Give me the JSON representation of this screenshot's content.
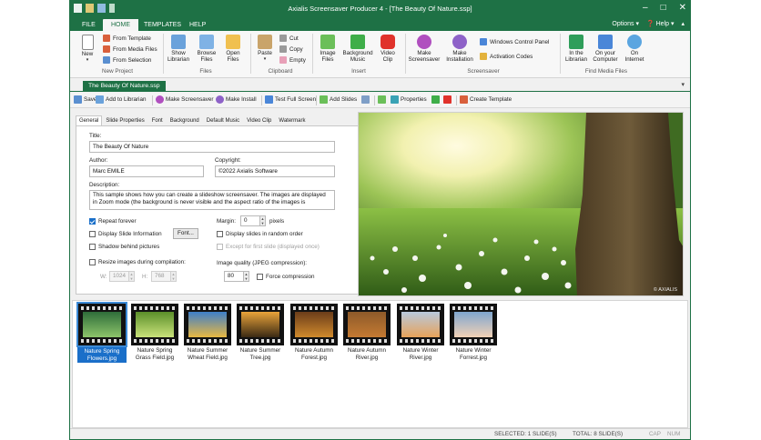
{
  "window": {
    "title": "Axialis Screensaver Producer 4 - [The Beauty Of Nature.ssp]",
    "controls": [
      "–",
      "□",
      "✕"
    ]
  },
  "menu_tabs": [
    "FILE",
    "HOME",
    "TEMPLATES",
    "HELP"
  ],
  "menu_right": {
    "options": "Options ▾",
    "help": "❓ Help ▾",
    "collapse": "▴"
  },
  "ribbon": {
    "groups": {
      "new_project": {
        "label": "New Project",
        "new": "New",
        "from_template": "From Template",
        "from_media": "From Media Files",
        "from_selection": "From Selection"
      },
      "files": {
        "label": "Files",
        "show_librarian": "Show Librarian",
        "browse_files": "Browse Files",
        "open_files": "Open Files"
      },
      "clipboard": {
        "label": "Clipboard",
        "paste": "Paste",
        "cut": "Cut",
        "copy": "Copy",
        "empty": "Empty"
      },
      "insert": {
        "label": "Insert",
        "image_files": "Image Files",
        "background_music": "Background Music",
        "video_clip": "Video Clip"
      },
      "screensaver": {
        "label": "Screensaver",
        "make_screensaver": "Make Screensaver",
        "make_installation": "Make Installation",
        "windows_control_panel": "Windows Control Panel",
        "activation_codes": "Activation Codes"
      },
      "find_media": {
        "label": "Find Media Files",
        "in_librarian": "In the Librarian",
        "on_computer": "On your Computer",
        "on_internet": "On Internet"
      }
    }
  },
  "document_tab": "The Beauty Of Nature.ssp",
  "toolbar": {
    "save": "Save",
    "add_to_librarian": "Add to Librarian",
    "make_screensaver": "Make Screensaver",
    "make_install": "Make Install",
    "test_full_screen": "Test Full Screen",
    "add_slides": "Add Slides",
    "properties": "Properties",
    "create_template": "Create Template"
  },
  "properties": {
    "tabs": [
      "General",
      "Slide Properties",
      "Font",
      "Background",
      "Default Music",
      "Video Clip",
      "Watermark"
    ],
    "title_label": "Title:",
    "title_value": "The Beauty Of Nature",
    "author_label": "Author:",
    "author_value": "Marc EMILE",
    "copyright_label": "Copyright:",
    "copyright_value": "©2022 Axialis Software",
    "description_label": "Description:",
    "description_value": "This sample shows how you can create a slideshow screensaver. The images are displayed in Zoom mode (the background is never visible and the aspect ratio of the images is",
    "repeat_forever": "Repeat forever",
    "display_slide_info": "Display Slide Information",
    "font_button": "Font...",
    "shadow_behind": "Shadow behind pictures",
    "margin_label": "Margin:",
    "margin_value": "0",
    "margin_unit": "pixels",
    "random_order": "Display slides in random order",
    "except_first": "Except for first slide (displayed once)",
    "resize_images": "Resize images during compilation:",
    "w_label": "W:",
    "w_value": "1024",
    "h_label": "H:",
    "h_value": "768",
    "image_quality_label": "Image quality (JPEG compression):",
    "image_quality_value": "80",
    "force_compression": "Force compression",
    "checked": {
      "repeat_forever": true,
      "display_slide_info": false,
      "shadow_behind": false,
      "random_order": false,
      "except_first": false,
      "resize_images": false,
      "force_compression": false
    }
  },
  "thumbnails": [
    {
      "caption": "Nature Spring Flowers.jpg",
      "selected": true,
      "c1": "#2f6d3a",
      "c2": "#8cc46a"
    },
    {
      "caption": "Nature Spring Grass Field.jpg",
      "selected": false,
      "c1": "#5b8f2a",
      "c2": "#c9e27a"
    },
    {
      "caption": "Nature Summer Wheat Field.jpg",
      "selected": false,
      "c1": "#3e7fc9",
      "c2": "#e8b842"
    },
    {
      "caption": "Nature Summer Tree.jpg",
      "selected": false,
      "c1": "#e9a33a",
      "c2": "#3b2a14"
    },
    {
      "caption": "Nature Autumn Forest.jpg",
      "selected": false,
      "c1": "#6b3d1a",
      "c2": "#d08a2c"
    },
    {
      "caption": "Nature Autumn River.jpg",
      "selected": false,
      "c1": "#8d5a2a",
      "c2": "#c47a32"
    },
    {
      "caption": "Nature Winter River.jpg",
      "selected": false,
      "c1": "#b9c9dd",
      "c2": "#e7a35a"
    },
    {
      "caption": "Nature Winter Forrest.jpg",
      "selected": false,
      "c1": "#7fa6cf",
      "c2": "#f1d1b6"
    }
  ],
  "status": {
    "selected": "SELECTED: 1 SLIDE(S)",
    "total": "TOTAL: 8 SLIDE(S)",
    "cap": "CAP",
    "num": "NUM"
  },
  "preview_watermark": "© AXIALIS"
}
